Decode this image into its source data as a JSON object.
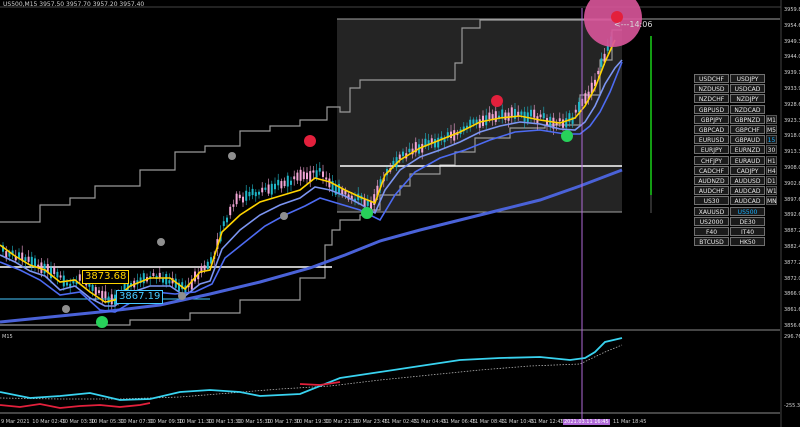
{
  "header": {
    "symbol_line": "US500,M15  3957.50 3957.70 3957.20 3957.40",
    "sub_window_label": "M15"
  },
  "price_labels": {
    "upper_line": "3873.68",
    "lower_line": "3867.19"
  },
  "countdown": "<---14:06",
  "y_axis_main": [
    "3959.85",
    "3954.60",
    "3949.35",
    "3944.00",
    "3939.15",
    "3933.90",
    "3928.60",
    "3923.35",
    "3918.00",
    "3913.35",
    "3908.00",
    "3902.85",
    "3897.60",
    "3892.65",
    "3887.20",
    "3882.40",
    "3877.20",
    "3872.05",
    "3866.90",
    "3861.65",
    "3856.65"
  ],
  "y_axis_sub": [
    "296.7681",
    "-255.3953"
  ],
  "x_axis": [
    "9 Mar 2021",
    "10 Mar 02:45",
    "10 Mar 03:30",
    "10 Mar 05:30",
    "10 Mar 07:30",
    "10 Mar 09:30",
    "10 Mar 11:30",
    "10 Mar 13:30",
    "10 Mar 15:30",
    "10 Mar 17:30",
    "10 Mar 19:30",
    "10 Mar 21:30",
    "10 Mar 23:45",
    "11 Mar 02:45",
    "11 Mar 04:45",
    "11 Mar 06:45",
    "11 Mar 08:45",
    "11 Mar 10:45",
    "11 Mar 12:45",
    "11 Mar 14:45",
    "2021.03.11 16:45",
    "11 Mar 18:45"
  ],
  "x_axis_highlight_index": 20,
  "symbol_panel": {
    "pairs": [
      [
        "USDCHF",
        "USDJPY"
      ],
      [
        "NZDUSD",
        "USDCAD"
      ],
      [
        "NZDCHF",
        "NZDJPY"
      ],
      [
        "GBPUSD",
        "NZDCAD"
      ],
      [
        "GBPJPY",
        "GBPNZD"
      ],
      [
        "GBPCAD",
        "GBPCHF"
      ],
      [
        "EURUSD",
        "GBPAUD"
      ],
      [
        "EURJPY",
        "EURNZD"
      ],
      [
        "CHFJPY",
        "EURAUD"
      ],
      [
        "CADCHF",
        "CADJPY"
      ],
      [
        "AUDNZD",
        "AUDUSD"
      ],
      [
        "AUDCHF",
        "AUDCAD"
      ],
      [
        "US30",
        "AUDCAD"
      ],
      [
        "XAUUSD",
        "US500"
      ],
      [
        "US2000",
        "DE30"
      ],
      [
        "F40",
        "IT40"
      ],
      [
        "BTCUSD",
        "HK50"
      ]
    ],
    "selected": "US500",
    "timeframes": [
      "M1",
      "M5",
      "15",
      "30",
      "H1",
      "H4",
      "D1",
      "W1",
      "MN"
    ],
    "selected_timeframe": "15"
  },
  "colors": {
    "background": "#000000",
    "bull_candle": "#1fb6c8",
    "bear_candle": "#f3a6d6",
    "band_line": "#9a9a9a",
    "ema_yellow": "#ffd400",
    "ema_light_blue": "#7c95f2",
    "ma_blue": "#4a62d8",
    "signal_red": "#e3203c",
    "signal_green": "#27d15a",
    "signal_gray": "#8f8f8f",
    "highlight_circle": "#d9559a",
    "cursor_line": "#b06ad8",
    "indicator_cyan": "#39d3f0",
    "indicator_red": "#e3203c",
    "green_bar": "#18c418"
  }
}
